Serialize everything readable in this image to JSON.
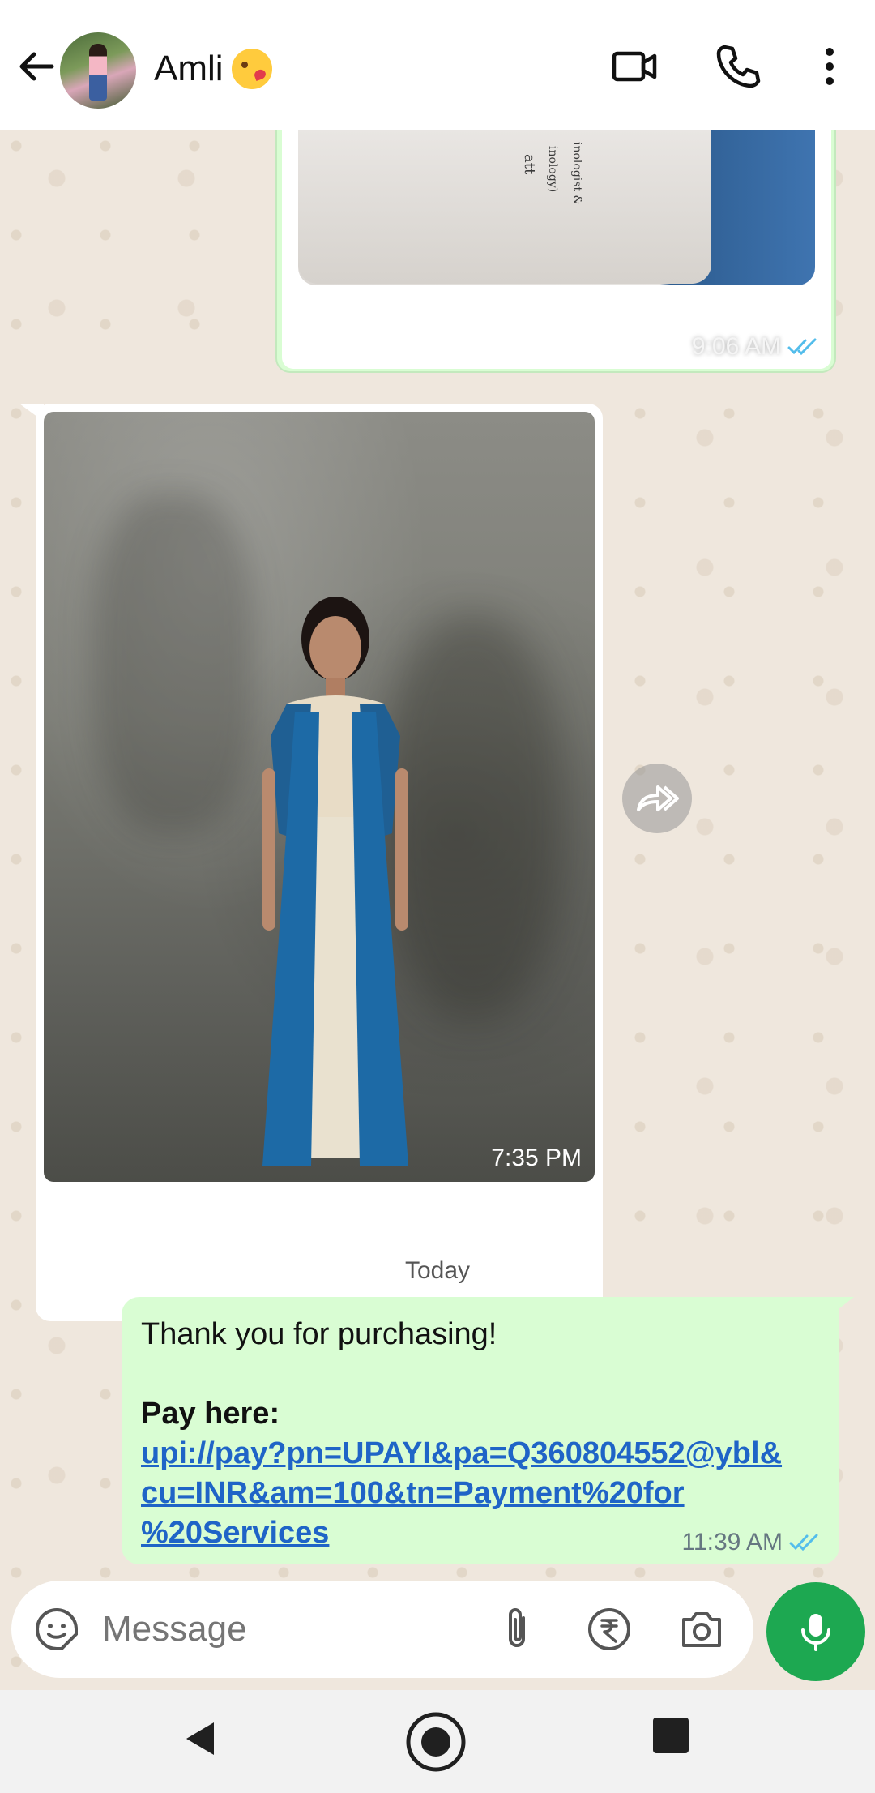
{
  "header": {
    "contact_name": "Amli",
    "emoji_icon": "kissing-face-emoji",
    "icons": [
      "back-arrow-icon",
      "video-call-icon",
      "phone-call-icon",
      "more-options-icon"
    ]
  },
  "messages": [
    {
      "type": "image",
      "direction": "outgoing",
      "time": "9:06 AM",
      "status": "read"
    },
    {
      "type": "image",
      "direction": "incoming",
      "time": "7:35 PM"
    },
    {
      "type": "date_separator",
      "label": "Today"
    },
    {
      "type": "text",
      "direction": "outgoing",
      "line1": "Thank you for purchasing!",
      "line2": "Pay here:",
      "link": "upi://pay?pn=UPAYI&pa=Q360804552@ybl&cu=INR&am=100&tn=Payment%20for%20Services",
      "link_display_1": "upi://pay?pn=UPAYI&pa=Q360804552@ybl&",
      "link_display_2": "cu=INR&am=100&tn=Payment%20for",
      "link_display_3": "%20Services",
      "time": "11:39 AM",
      "status": "read"
    }
  ],
  "composer": {
    "placeholder": "Message",
    "icons": [
      "sticker-icon",
      "attach-icon",
      "rupee-payment-icon",
      "camera-icon",
      "mic-icon"
    ]
  },
  "colors": {
    "outgoing_bubble": "#d9fdd3",
    "accent_green": "#1da851",
    "link_blue": "#1f64c7",
    "read_tick_blue": "#53bdeb",
    "chat_background": "#efe7dd"
  },
  "navbar": {
    "icons": [
      "nav-back-icon",
      "nav-home-icon",
      "nav-recents-icon"
    ]
  }
}
